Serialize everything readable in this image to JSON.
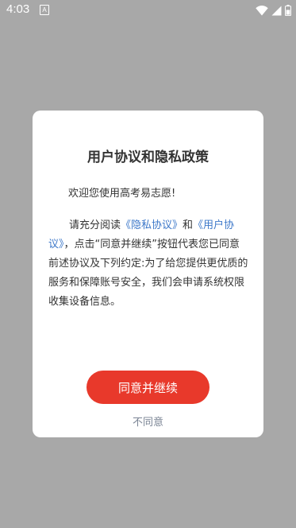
{
  "status_bar": {
    "time": "4:03",
    "a_badge": "A",
    "icons": [
      "wifi-icon",
      "cellular-signal-icon",
      "battery-icon"
    ]
  },
  "dialog": {
    "title": "用户协议和隐私政策",
    "welcome": "欢迎您使用高考易志愿!",
    "body": {
      "intro": "请充分阅读",
      "privacy_link": "《隐私协议》",
      "and": "和",
      "user_link": "《用户协议》",
      "rest": "，点击“同意并继续”按钮代表您已同意前述协议及下列约定:为了给您提供更优质的服务和保障账号安全，我们会申请系统权限收集设备信息。"
    },
    "agree_button": "同意并继续",
    "disagree_link": "不同意"
  },
  "colors": {
    "overlay": "#a8a8a8",
    "accent": "#e8392b",
    "link": "#3d78c9",
    "muted": "#7b8595"
  }
}
